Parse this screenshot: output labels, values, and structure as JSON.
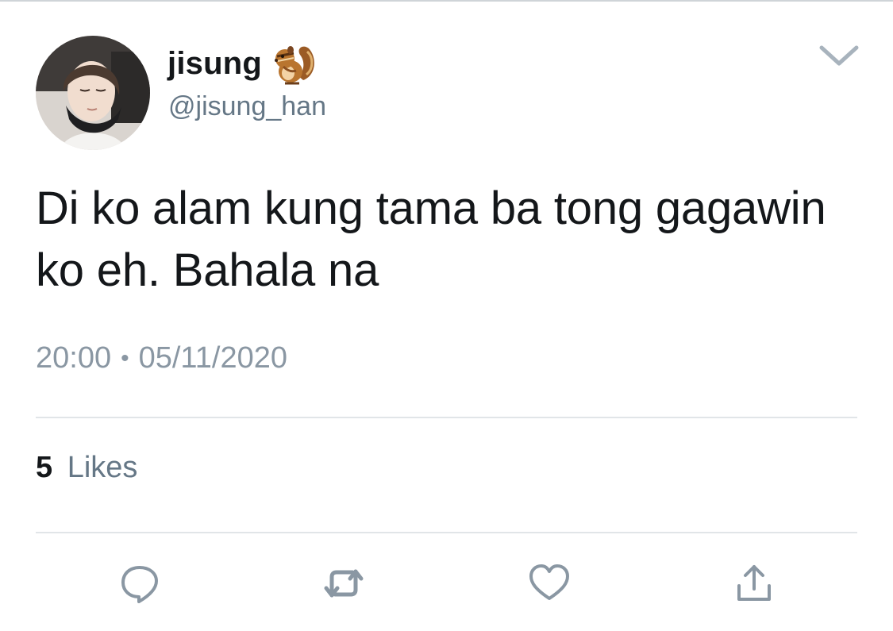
{
  "tweet": {
    "display_name": "jisung",
    "name_emoji": "chipmunk-emoji",
    "handle": "@jisung_han",
    "text": "Di ko alam kung tama ba tong gagawin ko eh. Bahala na",
    "time": "20:00",
    "separator": "•",
    "date": "05/11/2020",
    "likes_count": "5",
    "likes_label": "Likes"
  },
  "actions": {
    "reply_icon": "reply-icon",
    "retweet_icon": "retweet-icon",
    "like_icon": "heart-icon",
    "share_icon": "share-icon"
  },
  "colors": {
    "text": "#14171a",
    "secondary": "#657786",
    "icon": "#8a97a3",
    "divider": "#e1e5e8"
  }
}
